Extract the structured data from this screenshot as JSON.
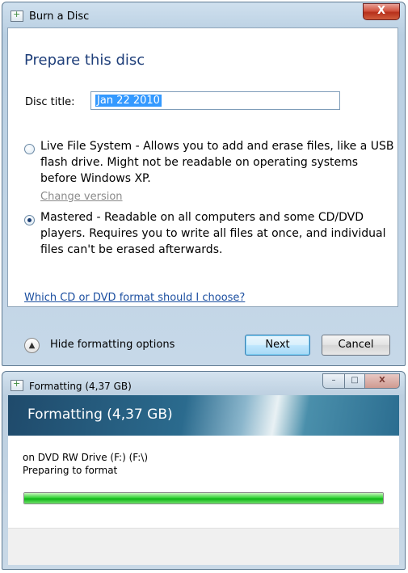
{
  "burn_dialog": {
    "title": "Burn a Disc",
    "close_label": "X",
    "heading": "Prepare this disc",
    "disc_title_label": "Disc title:",
    "disc_title_value": "Jan 22 2010",
    "options": [
      {
        "label": "Live File System - Allows you to add and erase files, like a USB flash drive. Might not be readable on operating systems before Windows XP.",
        "selected": false
      },
      {
        "label": "Mastered - Readable on all computers and some CD/DVD players. Requires you to write all files at once, and individual files can't be erased afterwards.",
        "selected": true
      }
    ],
    "change_version_link": "Change version",
    "format_help_link": "Which CD or DVD format should I choose?",
    "hide_options_label": "Hide formatting options",
    "next_button": "Next",
    "cancel_button": "Cancel"
  },
  "format_dialog": {
    "title": "Formatting (4,37 GB)",
    "banner_title": "Formatting (4,37 GB)",
    "drive_line": "on DVD RW Drive (F:) (F:\\)",
    "status_line": "Preparing to format",
    "progress_fraction": 1.0,
    "minimize_label": "–",
    "maximize_label": "□",
    "close_label": "X"
  }
}
